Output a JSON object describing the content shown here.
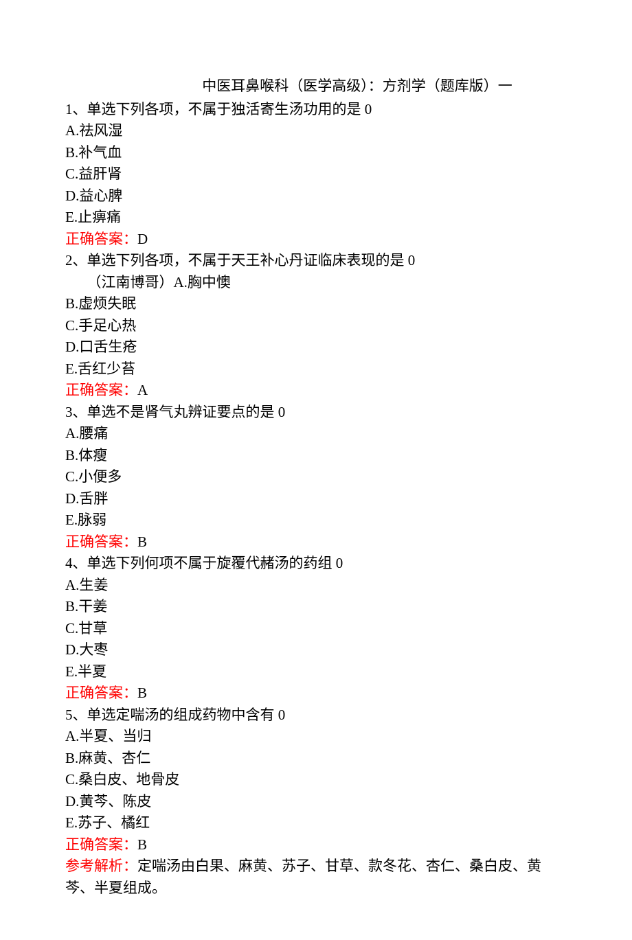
{
  "title": "中医耳鼻喉科（医学高级）：方剂学（题库版）一",
  "questions": [
    {
      "num": "1、",
      "type": "单选",
      "stem": "下列各项，不属于独活寄生汤功用的是 0",
      "options": [
        "A.祛风湿",
        "B.补气血",
        "C.益肝肾",
        "D.益心脾",
        "E.止痹痛"
      ],
      "answer_label": "正确答案：",
      "answer": "D"
    },
    {
      "num": "2、",
      "type": "单选",
      "stem": "下列各项，不属于天王补心丹证临床表现的是 0",
      "extra_line": "（江南博哥）A.胸中懊",
      "options": [
        "B.虚烦失眠",
        "C.手足心热",
        "D.口舌生疮",
        "E.舌红少苔"
      ],
      "answer_label": "正确答案：",
      "answer": "A"
    },
    {
      "num": "3、",
      "type": "单选",
      "stem": "不是肾气丸辨证要点的是 0",
      "options": [
        "A.腰痛",
        "B.体瘦",
        "C.小便多",
        "D.舌胖",
        "E.脉弱"
      ],
      "answer_label": "正确答案：",
      "answer": "B"
    },
    {
      "num": "4、",
      "type": "单选",
      "stem": "下列何项不属于旋覆代赭汤的药组 0",
      "options": [
        "A.生姜",
        "B.干姜",
        "C.甘草",
        "D.大枣",
        "E.半夏"
      ],
      "answer_label": "正确答案：",
      "answer": "B"
    },
    {
      "num": "5、",
      "type": "单选",
      "stem": "定喘汤的组成药物中含有 0",
      "options": [
        "A.半夏、当归",
        "B.麻黄、杏仁",
        "C.桑白皮、地骨皮",
        "D.黄芩、陈皮",
        "E.苏子、橘红"
      ],
      "answer_label": "正确答案：",
      "answer": "B",
      "analysis_label": "参考解析：",
      "analysis": "定喘汤由白果、麻黄、苏子、甘草、款冬花、杏仁、桑白皮、黄芩、半夏组成。"
    }
  ]
}
